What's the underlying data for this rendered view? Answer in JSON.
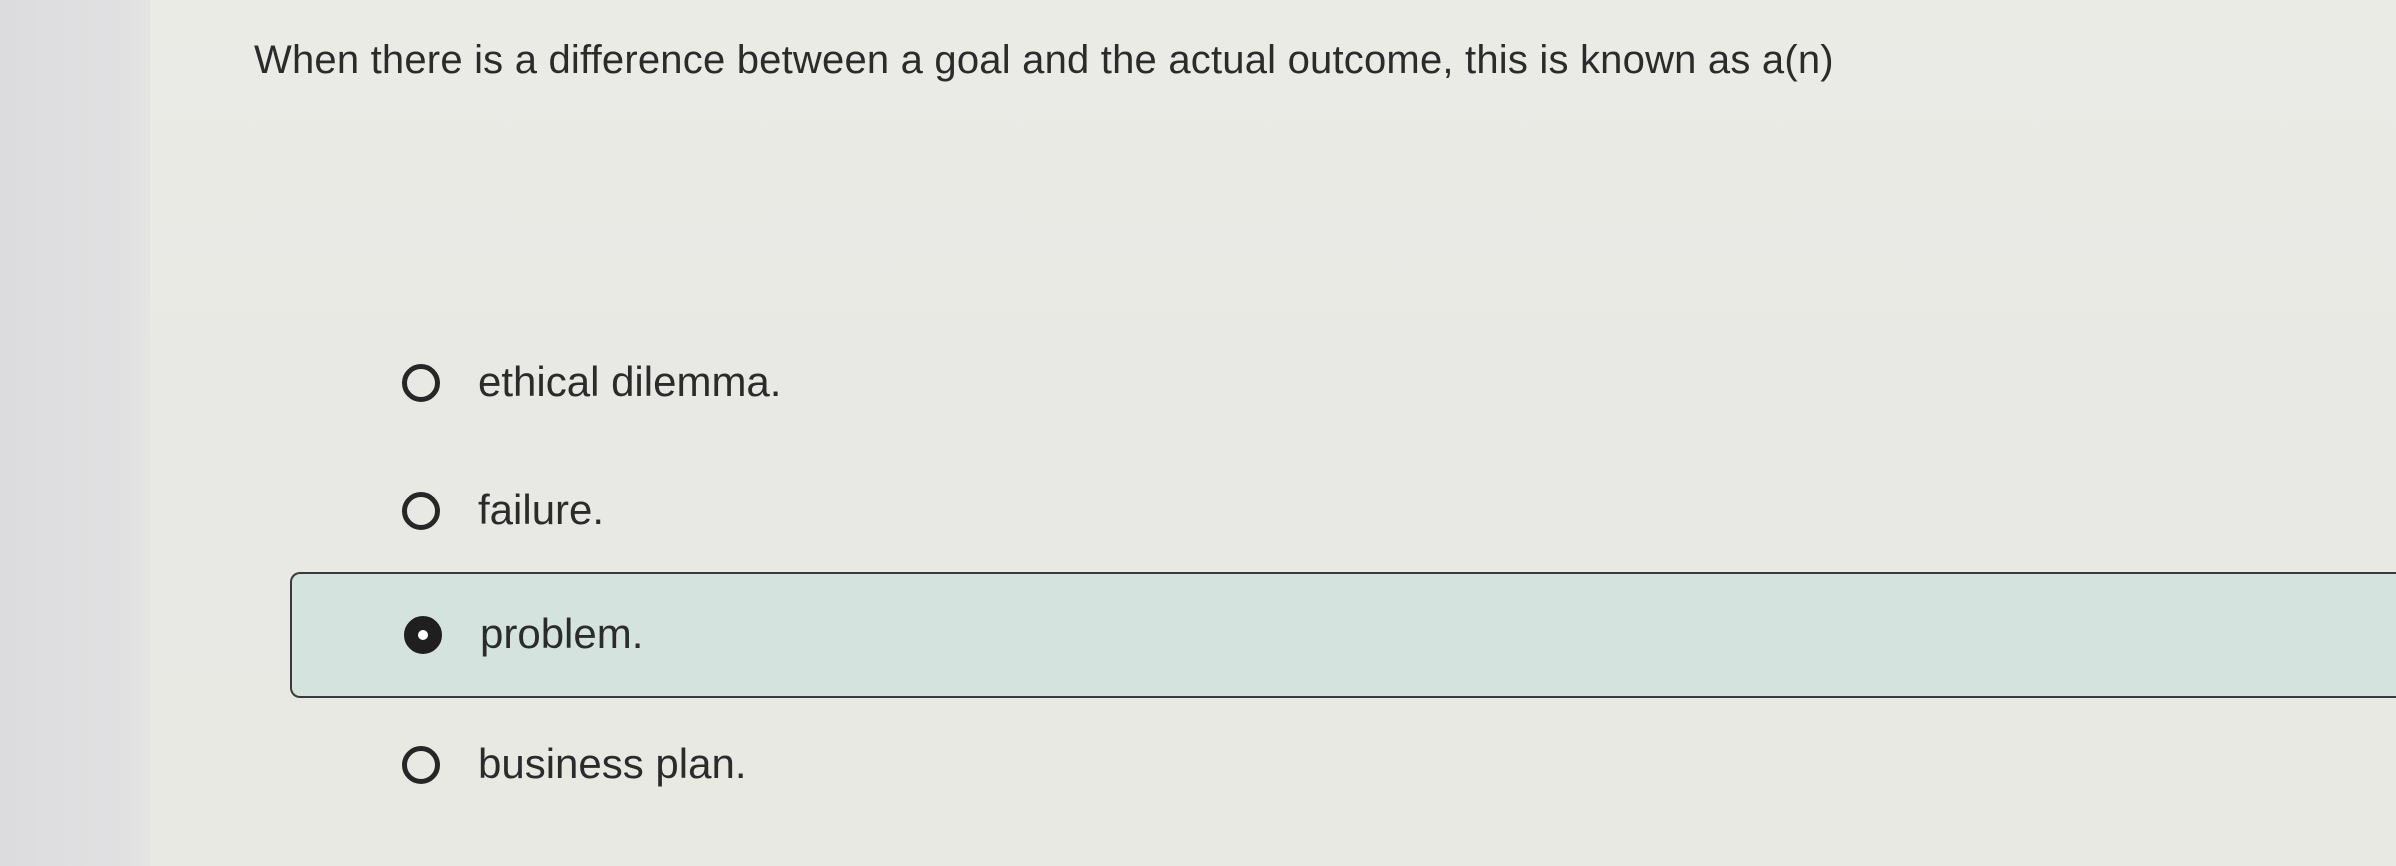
{
  "question": {
    "text": "When there is a difference between a goal and the actual outcome, this is known as a(n)"
  },
  "options": [
    {
      "label": "ethical dilemma.",
      "selected": false
    },
    {
      "label": "failure.",
      "selected": false
    },
    {
      "label": "problem.",
      "selected": true
    },
    {
      "label": "business plan.",
      "selected": false
    }
  ],
  "colors": {
    "selected_background": "#d5e3de",
    "selected_border": "#3a3a3a",
    "radio": "#262626",
    "text": "#2b2b2b"
  }
}
